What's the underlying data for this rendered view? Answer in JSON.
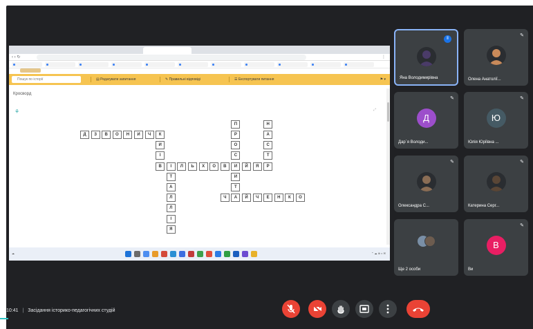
{
  "meeting": {
    "time": "10:41",
    "separator": "|",
    "title": "Засідання історико-педагогічних студій"
  },
  "browser": {
    "tabs": [
      "",
      "",
      "",
      "",
      "",
      "",
      ""
    ],
    "address": "",
    "toolbar": {
      "search_placeholder": "Пошук по історії",
      "edit_question": "Редагувати запитання",
      "correct_answers": "Правильні відповіді",
      "export": "Експортувати питання"
    },
    "page_title": "Кросворд",
    "page_right": ""
  },
  "crossword": {
    "across": [
      {
        "row": 0,
        "col": 0,
        "word": "ДЗВОНИЧК"
      },
      {
        "row": 3,
        "col": 7,
        "word": "ВІЛЬХОВИЙЯР"
      },
      {
        "row": 6,
        "col": 13,
        "word": "ЧАЙЧЕНКО"
      }
    ],
    "down": [
      {
        "row": 0,
        "col": 7,
        "word": "КИІВ"
      },
      {
        "row": 3,
        "col": 8,
        "word": "ІТАЛЛІЯ"
      },
      {
        "row": -1,
        "col": 14,
        "word": "ПРОСТИТ"
      },
      {
        "row": -1,
        "col": 17,
        "word": "НАСТ"
      }
    ]
  },
  "participants": [
    {
      "name": "Яна Володимирівна",
      "type": "photo",
      "color": "#4a3b68",
      "speaking": true,
      "mic": ""
    },
    {
      "name": "Олена Анатолії...",
      "type": "photo",
      "color": "#c98a5a",
      "speaking": false,
      "mic": "✎"
    },
    {
      "name": "Дар`я Володи...",
      "type": "letter",
      "letter": "Д",
      "color": "#9c4ecb",
      "speaking": false,
      "mic": "✎"
    },
    {
      "name": "Юлія Юріївна ...",
      "type": "letter",
      "letter": "Ю",
      "color": "#455a64",
      "speaking": false,
      "mic": "✎"
    },
    {
      "name": "Олександра С...",
      "type": "photo",
      "color": "#8a6d55",
      "speaking": false,
      "mic": "✎"
    },
    {
      "name": "Катерина Серг...",
      "type": "photo",
      "color": "#5a4636",
      "speaking": false,
      "mic": "✎"
    },
    {
      "name": "Ще 2 особи",
      "type": "group",
      "color": "#6d5c4f",
      "speaking": false,
      "mic": ""
    },
    {
      "name": "Ви",
      "type": "letter",
      "letter": "В",
      "color": "#e91e63",
      "speaking": false,
      "mic": "✎"
    }
  ],
  "controls": {
    "mic_icon": "mic-off-icon",
    "cam_icon": "camera-off-icon",
    "hand_icon": "raise-hand-icon",
    "present_icon": "present-icon",
    "more_icon": "more-icon",
    "hangup_icon": "hangup-icon"
  }
}
